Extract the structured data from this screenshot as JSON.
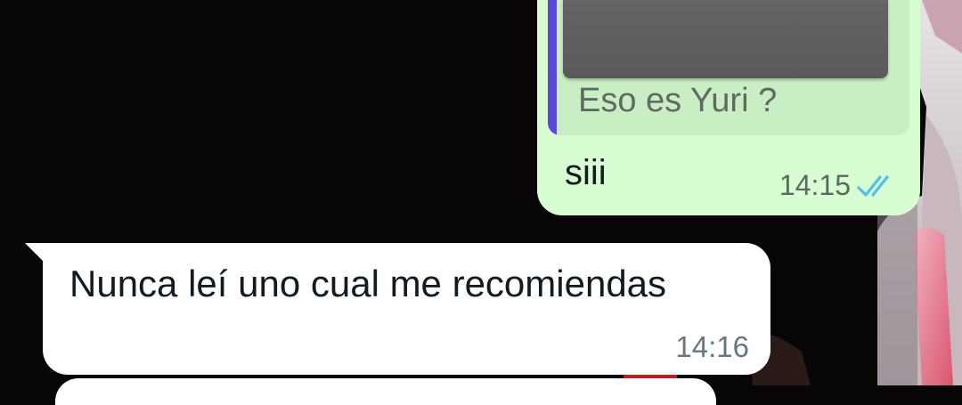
{
  "chat": {
    "outgoing": {
      "quoted_text": "Eso es Yuri ?",
      "text": "siii",
      "time": "14:15",
      "status_icon": "double-check-read-icon"
    },
    "incoming": {
      "text": "Nunca leí uno cual me recomiendas",
      "time": "14:16"
    }
  },
  "colors": {
    "outgoing_bubble": "#d9fdd3",
    "quote_bar": "#5b4ad6",
    "read_ticks": "#53bdeb",
    "incoming_bubble": "#ffffff",
    "background": "#070505"
  }
}
